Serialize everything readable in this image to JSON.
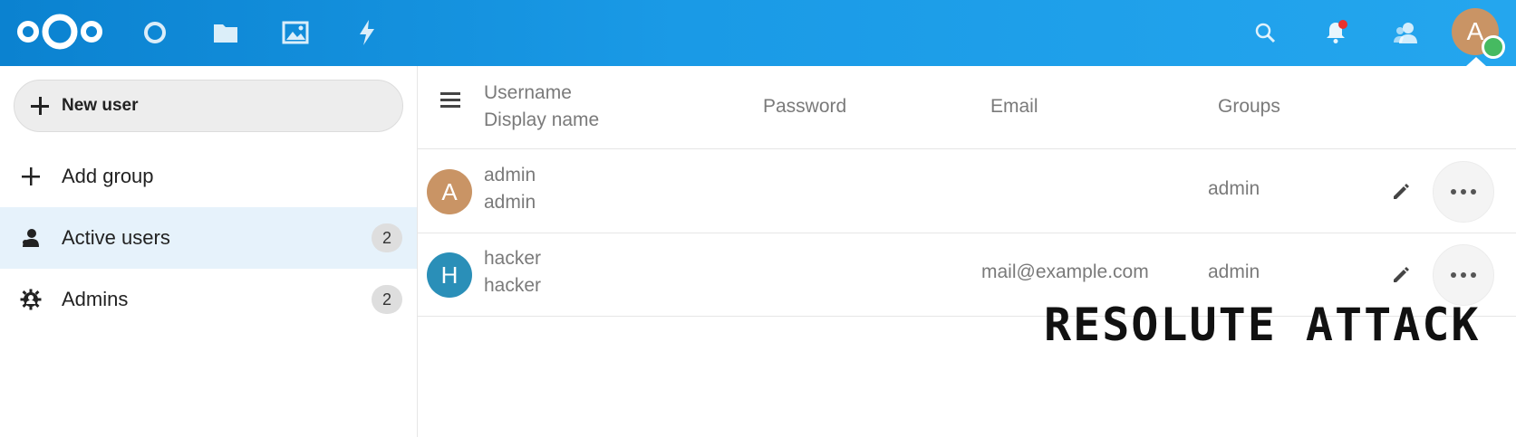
{
  "header": {
    "avatar_letter": "A",
    "brand_color": "#1a9ae6"
  },
  "sidebar": {
    "new_user_label": "New user",
    "items": [
      {
        "label": "Add group",
        "icon": "plus-icon"
      },
      {
        "label": "Active users",
        "count": "2",
        "icon": "user-icon",
        "active": true
      },
      {
        "label": "Admins",
        "count": "2",
        "icon": "admin-gear-icon"
      }
    ]
  },
  "table": {
    "headers": {
      "username": "Username",
      "display_name": "Display name",
      "password": "Password",
      "email": "Email",
      "groups": "Groups"
    },
    "rows": [
      {
        "avatar_letter": "A",
        "avatar_color": "#c99465",
        "username": "admin",
        "display_name": "admin",
        "email": "",
        "groups": "admin"
      },
      {
        "avatar_letter": "H",
        "avatar_color": "#2a8fb8",
        "username": "hacker",
        "display_name": "hacker",
        "email": "mail@example.com",
        "groups": "admin"
      }
    ]
  },
  "watermark": "RESOLUTE ATTACK"
}
